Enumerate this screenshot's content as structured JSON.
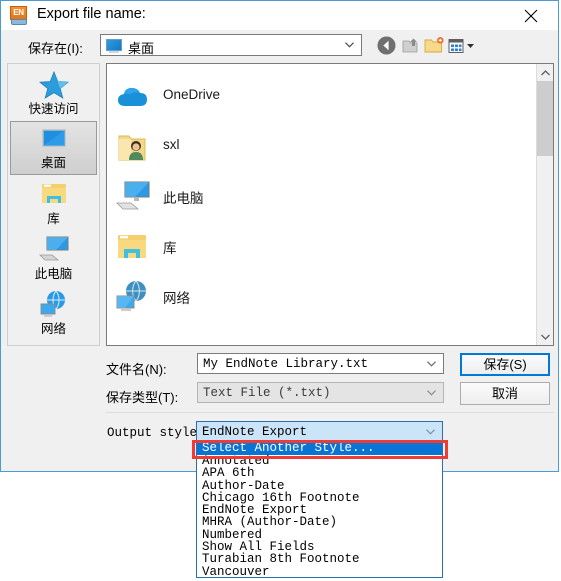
{
  "window": {
    "title": "Export file name:",
    "app_icon": "endnote-icon",
    "icon_text": "EN",
    "close_label": "✕",
    "accent_color": "#0078d7",
    "frame_color": "#4a9ad4"
  },
  "lookin": {
    "label": "保存在(I):",
    "value": "桌面",
    "icon": "desktop-icon"
  },
  "toolbar": {
    "buttons": [
      {
        "name": "back-button",
        "icon": "back-arrow-icon"
      },
      {
        "name": "up-one-level-button",
        "icon": "up-folder-icon"
      },
      {
        "name": "new-folder-button",
        "icon": "new-folder-icon"
      },
      {
        "name": "views-button",
        "icon": "views-grid-icon"
      }
    ]
  },
  "places": {
    "items": [
      {
        "label": "快速访问",
        "icon": "star-icon",
        "selected": false
      },
      {
        "label": "桌面",
        "icon": "desktop-icon",
        "selected": true
      },
      {
        "label": "库",
        "icon": "library-icon",
        "selected": false
      },
      {
        "label": "此电脑",
        "icon": "this-pc-icon",
        "selected": false
      },
      {
        "label": "网络",
        "icon": "network-icon",
        "selected": false
      }
    ]
  },
  "filelist": {
    "items": [
      {
        "label": "OneDrive",
        "icon": "onedrive-cloud-icon"
      },
      {
        "label": "sxl",
        "icon": "user-folder-icon"
      },
      {
        "label": "此电脑",
        "icon": "this-pc-icon"
      },
      {
        "label": "库",
        "icon": "library-folder-icon"
      },
      {
        "label": "网络",
        "icon": "network-globe-icon"
      }
    ]
  },
  "form": {
    "filename_label": "文件名(N):",
    "filename_value": "My EndNote Library.txt",
    "savetype_label": "保存类型(T):",
    "savetype_value": "Text File (*.txt)",
    "save_button": "保存(S)",
    "cancel_button": "取消"
  },
  "output_style": {
    "label": "Output style:",
    "value": "EndNote Export",
    "options": [
      "Select Another Style...",
      "Annotated",
      "APA 6th",
      "Author-Date",
      "Chicago 16th Footnote",
      "EndNote Export",
      "MHRA (Author-Date)",
      "Numbered",
      "Show All Fields",
      "Turabian 8th Footnote",
      "Vancouver"
    ],
    "selected_index": 0,
    "highlight_color": "#0a74d4",
    "annotation_box_color": "#ef3b35"
  }
}
